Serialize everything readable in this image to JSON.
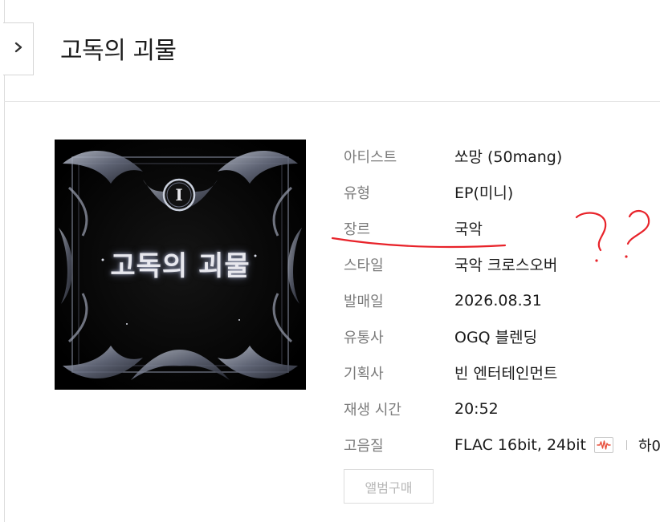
{
  "album": {
    "title": "고독의 괴물",
    "cover_text": "고독의 괴물",
    "cover_mark": "I"
  },
  "info": {
    "rows": [
      {
        "label": "아티스트",
        "value": "쏘망 (50mang)"
      },
      {
        "label": "유형",
        "value": "EP(미니)"
      },
      {
        "label": "장르",
        "value": "국악"
      },
      {
        "label": "스타일",
        "value": "국악 크로스오버"
      },
      {
        "label": "발매일",
        "value": "2026.08.31"
      },
      {
        "label": "유통사",
        "value": "OGQ 블렌딩"
      },
      {
        "label": "기획사",
        "value": "빈 엔터테인먼트"
      },
      {
        "label": "재생 시간",
        "value": "20:52"
      },
      {
        "label": "고음질",
        "value": "FLAC 16bit, 24bit"
      }
    ],
    "hq_extra": "하0"
  },
  "buttons": {
    "buy": "앨범구매"
  },
  "icons": {
    "sidebar_toggle": "chevron-right-icon",
    "hq": "waveform-icon"
  },
  "colors": {
    "annotation_red": "#e8232a",
    "label_gray": "#7b7b7b",
    "hq_icon_red": "#e8503c"
  }
}
